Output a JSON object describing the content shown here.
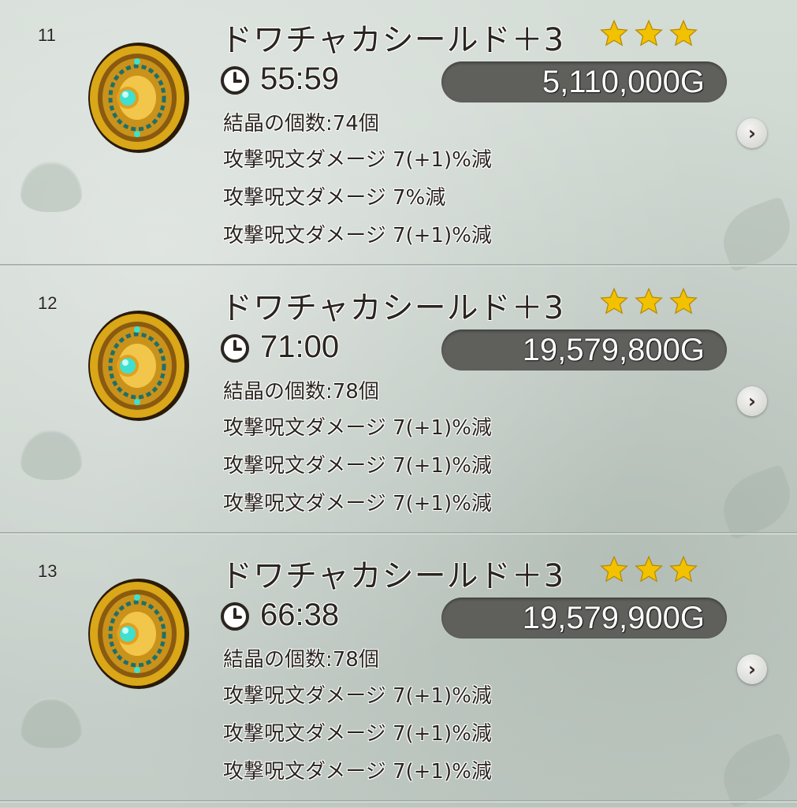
{
  "colors": {
    "background": "#c9d2cc",
    "text": "#2b2520",
    "price_pill": "#5f5f5c",
    "star": "#f2c200",
    "shield_gold": "#d9a718",
    "shield_gem": "#3fe0d0"
  },
  "icons": {
    "item": "shield-icon",
    "timer": "clock-icon",
    "rarity": "star-icon",
    "detail": "chevron-right-icon"
  },
  "listings": [
    {
      "index": "11",
      "name": "ドワチャカシールド＋3",
      "stars": 3,
      "time": "55:59",
      "price": "5,110,000G",
      "crystals": "結晶の個数:74個",
      "effects": [
        "攻撃呪文ダメージ 7(+1)%減",
        "攻撃呪文ダメージ 7%減",
        "攻撃呪文ダメージ 7(+1)%減"
      ],
      "detail_label": "›"
    },
    {
      "index": "12",
      "name": "ドワチャカシールド＋3",
      "stars": 3,
      "time": "71:00",
      "price": "19,579,800G",
      "crystals": "結晶の個数:78個",
      "effects": [
        "攻撃呪文ダメージ 7(+1)%減",
        "攻撃呪文ダメージ 7(+1)%減",
        "攻撃呪文ダメージ 7(+1)%減"
      ],
      "detail_label": "›"
    },
    {
      "index": "13",
      "name": "ドワチャカシールド＋3",
      "stars": 3,
      "time": "66:38",
      "price": "19,579,900G",
      "crystals": "結晶の個数:78個",
      "effects": [
        "攻撃呪文ダメージ 7(+1)%減",
        "攻撃呪文ダメージ 7(+1)%減",
        "攻撃呪文ダメージ 7(+1)%減"
      ],
      "detail_label": "›"
    }
  ]
}
